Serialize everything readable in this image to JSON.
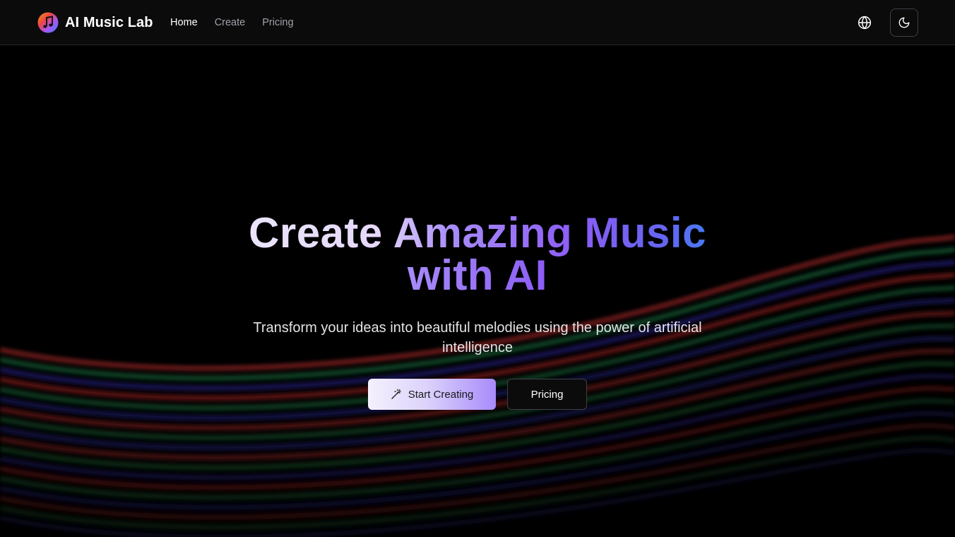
{
  "app": {
    "brand_name": "AI Music Lab",
    "logo_icon": "music-note-logo-icon"
  },
  "nav": {
    "links": [
      {
        "label": "Home",
        "active": true
      },
      {
        "label": "Create",
        "active": false
      },
      {
        "label": "Pricing",
        "active": false
      }
    ],
    "language_icon": "globe-icon",
    "theme_icon": "moon-icon"
  },
  "hero": {
    "title_line1": "Create Amazing Music",
    "title_line2": "with AI",
    "subtitle": "Transform your ideas into beautiful melodies using the power of artificial intelligence",
    "primary_button": {
      "label": "Start Creating",
      "icon": "magic-wand-icon"
    },
    "secondary_button": {
      "label": "Pricing"
    }
  },
  "colors": {
    "background": "#000000",
    "navbar": "#0b0b0c",
    "accent_purple": "#8b5cf6",
    "accent_blue": "#3b82f6",
    "wave_red": "#7f1d1d",
    "wave_green": "#14532d",
    "wave_blue": "#1e1b6b"
  }
}
